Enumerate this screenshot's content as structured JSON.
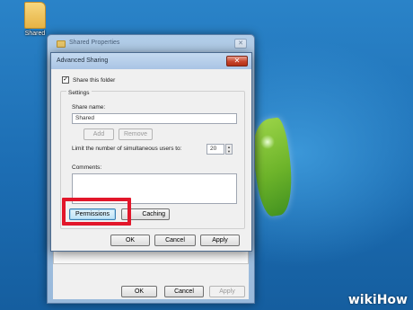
{
  "desktop": {
    "icon_label": "Shared"
  },
  "back_window": {
    "title": "Shared Properties",
    "close_glyph": "✕",
    "buttons": {
      "ok": "OK",
      "cancel": "Cancel",
      "apply": "Apply"
    }
  },
  "dialog": {
    "title": "Advanced Sharing",
    "close_glyph": "✕",
    "share_checkbox_label": "Share this folder",
    "share_checkbox_checked": true,
    "settings_label": "Settings",
    "share_name_label": "Share name:",
    "share_name_value": "Shared",
    "add_label": "Add",
    "remove_label": "Remove",
    "limit_label": "Limit the number of simultaneous users to:",
    "limit_value": "20",
    "comments_label": "Comments:",
    "comments_value": "",
    "permissions_label": "Permissions",
    "caching_label": "Caching",
    "buttons": {
      "ok": "OK",
      "cancel": "Cancel",
      "apply": "Apply"
    }
  },
  "watermark": {
    "wiki": "wiki",
    "how": "How"
  },
  "colors": {
    "highlight": "#e2162a",
    "desktop": "#1f72b8"
  }
}
